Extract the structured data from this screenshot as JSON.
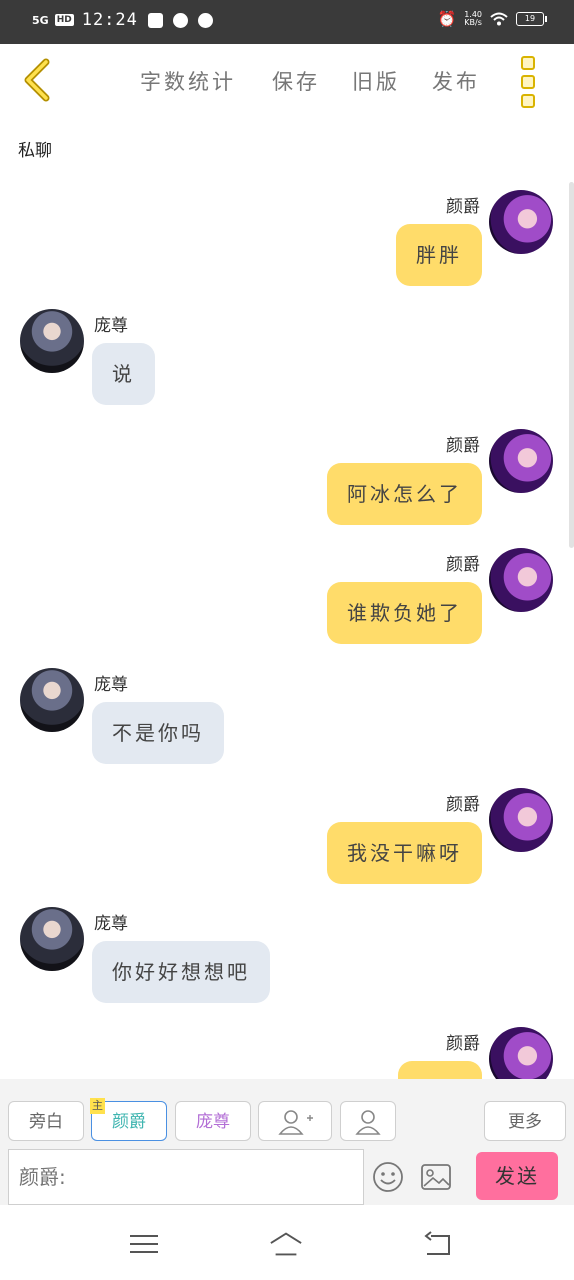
{
  "status_bar": {
    "network": "5G",
    "hd": "HD",
    "time": "12:24",
    "speed": "1.40",
    "speed_unit": "KB/s",
    "battery": "19"
  },
  "toolbar": {
    "word_count": "字数统计",
    "save": "保存",
    "old_version": "旧版",
    "publish": "发布"
  },
  "chat_type": "私聊",
  "messages": [
    {
      "side": "right",
      "name": "颜爵",
      "text": "胖胖"
    },
    {
      "side": "left",
      "name": "庞尊",
      "text": "说"
    },
    {
      "side": "right",
      "name": "颜爵",
      "text": "阿冰怎么了"
    },
    {
      "side": "right",
      "name": "颜爵",
      "text": "谁欺负她了"
    },
    {
      "side": "left",
      "name": "庞尊",
      "text": "不是你吗"
    },
    {
      "side": "right",
      "name": "颜爵",
      "text": "我没干嘛呀"
    },
    {
      "side": "left",
      "name": "庞尊",
      "text": "你好好想想吧"
    },
    {
      "side": "right",
      "name": "颜爵",
      "text": ""
    }
  ],
  "roles": {
    "narration": "旁白",
    "role1": "颜爵",
    "role1_tag": "主",
    "role2": "庞尊",
    "more": "更多"
  },
  "input": {
    "placeholder": "颜爵:"
  },
  "send_label": "发送",
  "colors": {
    "right_bubble": "#ffdc6a",
    "left_bubble": "#e3e9f1",
    "send": "#ff6f9e",
    "accent": "#d9b300"
  }
}
